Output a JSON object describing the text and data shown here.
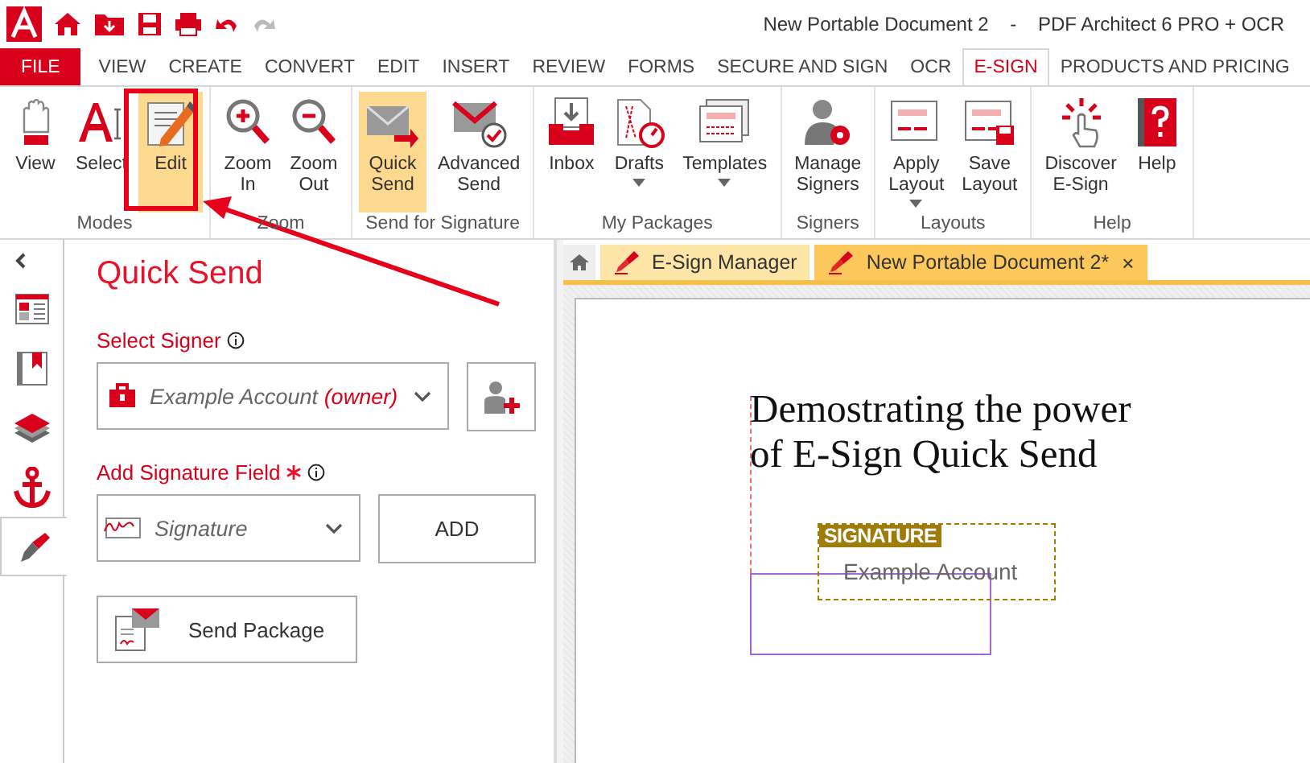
{
  "title_bar": {
    "title": "New Portable Document 2    -    PDF Architect 6 PRO + OCR"
  },
  "menu_tabs": [
    {
      "label": "FILE",
      "kind": "file",
      "selected": false
    },
    {
      "label": "VIEW",
      "kind": "tab",
      "selected": false
    },
    {
      "label": "CREATE",
      "kind": "tab",
      "selected": false
    },
    {
      "label": "CONVERT",
      "kind": "tab",
      "selected": false
    },
    {
      "label": "EDIT",
      "kind": "tab",
      "selected": false
    },
    {
      "label": "INSERT",
      "kind": "tab",
      "selected": false
    },
    {
      "label": "REVIEW",
      "kind": "tab",
      "selected": false
    },
    {
      "label": "FORMS",
      "kind": "tab",
      "selected": false
    },
    {
      "label": "SECURE AND SIGN",
      "kind": "tab",
      "selected": false
    },
    {
      "label": "OCR",
      "kind": "tab",
      "selected": false
    },
    {
      "label": "E-SIGN",
      "kind": "tab",
      "selected": true
    },
    {
      "label": "PRODUCTS AND PRICING",
      "kind": "tab",
      "selected": false
    }
  ],
  "ribbon_groups": [
    {
      "label": "Modes",
      "buttons": [
        {
          "label": "View",
          "selected": false,
          "dropdown": false
        },
        {
          "label": "Select",
          "selected": false,
          "dropdown": false
        },
        {
          "label": "Edit",
          "selected": true,
          "dropdown": false
        }
      ]
    },
    {
      "label": "Zoom",
      "buttons": [
        {
          "label": "Zoom\nIn",
          "selected": false,
          "dropdown": false
        },
        {
          "label": "Zoom\nOut",
          "selected": false,
          "dropdown": false
        }
      ]
    },
    {
      "label": "Send for Signature",
      "buttons": [
        {
          "label": "Quick\nSend",
          "selected": true,
          "dropdown": false
        },
        {
          "label": "Advanced\nSend",
          "selected": false,
          "dropdown": false
        }
      ]
    },
    {
      "label": "My Packages",
      "buttons": [
        {
          "label": "Inbox",
          "selected": false,
          "dropdown": false
        },
        {
          "label": "Drafts",
          "selected": false,
          "dropdown": true
        },
        {
          "label": "Templates",
          "selected": false,
          "dropdown": true
        }
      ]
    },
    {
      "label": "Signers",
      "buttons": [
        {
          "label": "Manage\nSigners",
          "selected": false,
          "dropdown": false
        }
      ]
    },
    {
      "label": "Layouts",
      "buttons": [
        {
          "label": "Apply\nLayout",
          "selected": false,
          "dropdown": true
        },
        {
          "label": "Save\nLayout",
          "selected": false,
          "dropdown": false
        }
      ]
    },
    {
      "label": "Help",
      "buttons": [
        {
          "label": "Discover\nE-Sign",
          "selected": false,
          "dropdown": false
        },
        {
          "label": "Help",
          "selected": false,
          "dropdown": false
        }
      ]
    }
  ],
  "side_rail": [
    {
      "selected": false
    },
    {
      "selected": false
    },
    {
      "selected": false
    },
    {
      "selected": false
    },
    {
      "selected": true
    }
  ],
  "panel": {
    "title": "Quick Send",
    "signer_label": "Select Signer",
    "signer_name": "Example Account",
    "signer_role": "(owner)",
    "field_label": "Add Signature Field",
    "field_required": true,
    "field_type": "Signature",
    "add_button": "ADD",
    "send_button": "Send Package"
  },
  "doc_tabs": [
    {
      "label": "E-Sign Manager",
      "selected": false,
      "closable": false
    },
    {
      "label": "New Portable Document 2*",
      "selected": true,
      "closable": true
    }
  ],
  "close_glyph": "×",
  "document": {
    "heading": "Demostrating the power\nof E-Sign Quick Send",
    "signature_tag": "SIGNATURE",
    "signature_signer": "Example Account"
  }
}
